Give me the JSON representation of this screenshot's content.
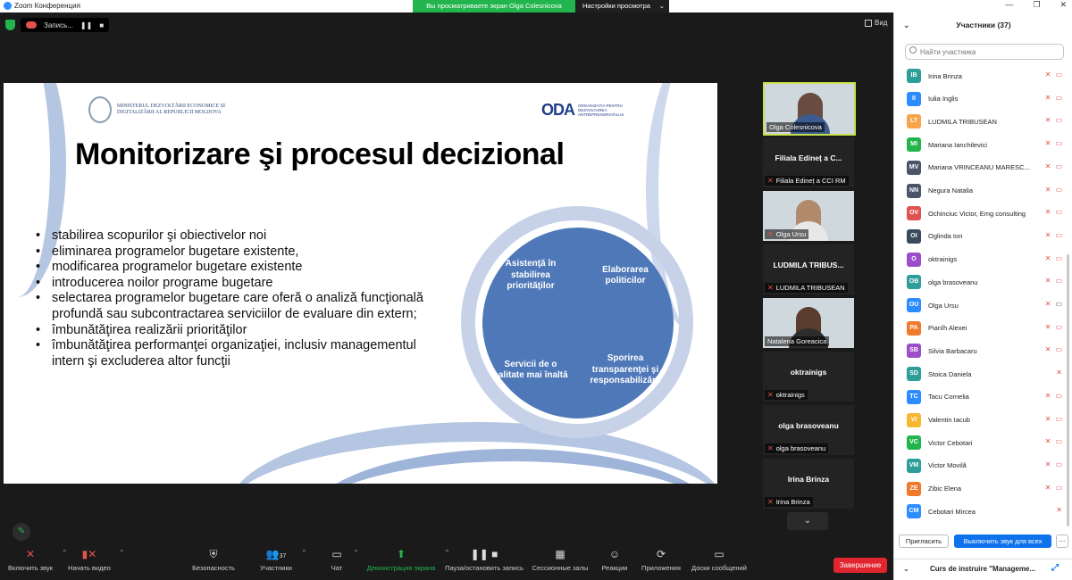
{
  "window": {
    "app_title": "Zoom Конференция",
    "controls": [
      "—",
      "❐",
      "✕"
    ]
  },
  "share_banner": {
    "text": "Вы просматриваете экран Olga Colesnicova",
    "settings_label": "Настройки просмотра",
    "settings_caret": "⌄"
  },
  "meeting_top": {
    "recording_label": "Запись...",
    "pause_glyph": "❚❚",
    "stop_glyph": "■",
    "view_label": "Вид"
  },
  "slide": {
    "ministry_text": "MINISTERUL DEZVOLTĂRII ECONOMICE ȘI DIGITALIZĂRII AL REPUBLICII MOLDOVA",
    "oda_logo": "ODA",
    "oda_sub": "ORGANIZAȚIA PENTRU DEZVOLTAREA ANTREPRENORIATULUI",
    "title": "Monitorizare şi procesul decizional",
    "bullets": [
      "stabilirea scopurilor şi obiectivelor noi",
      "eliminarea programelor bugetare existente,",
      "modificarea programelor bugetare existente",
      "introducerea noilor programe bugetare",
      "selectarea programelor bugetare care oferă o analiză funcţională profundă sau subcontractarea serviciilor de evaluare din extern;",
      "îmbunătăţirea realizării priorităţilor",
      "îmbunătăţirea performanţei organizaţiei, inclusiv managementul intern şi excluderea altor funcţii"
    ],
    "cycle": [
      "Asistenţă în stabilirea priorităţilor",
      "Elaborarea politicilor",
      "Servicii de o calitate mai înaltă",
      "Sporirea transparenţei şi responsabilizării"
    ]
  },
  "video_tiles": [
    {
      "label": "Olga Colesnicova",
      "big_name": "",
      "muted": false,
      "video": true
    },
    {
      "label": "Filiala Edineț a CCI RM",
      "big_name": "Filiala Edineț a C...",
      "muted": true,
      "video": false
    },
    {
      "label": "Olga Ursu",
      "big_name": "",
      "muted": true,
      "video": true
    },
    {
      "label": "LUDMILA TRIBUSEAN",
      "big_name": "LUDMILA TRIBUS...",
      "muted": true,
      "video": false
    },
    {
      "label": "Natalena Goreacica",
      "big_name": "",
      "muted": false,
      "video": true
    },
    {
      "label": "oktrainigs",
      "big_name": "oktrainigs",
      "muted": true,
      "video": false
    },
    {
      "label": "olga brasoveanu",
      "big_name": "olga brasoveanu",
      "muted": true,
      "video": false
    },
    {
      "label": "Irina Brinza",
      "big_name": "Irina Brinza",
      "muted": true,
      "video": false
    }
  ],
  "video_scroll_glyph": "⌄",
  "toolbar": {
    "mute": "Включить звук",
    "video": "Начать видео",
    "security": "Безопасность",
    "participants": "Участники",
    "participants_count": "37",
    "chat": "Чат",
    "share": "Демонстрация экрана",
    "pause_record": "Пауза/остановить запись",
    "breakout": "Сессионные залы",
    "reactions": "Реакции",
    "apps": "Приложения",
    "whiteboard": "Доски сообщений",
    "end": "Завершение",
    "caret": "^"
  },
  "panel": {
    "title": "Участники (37)",
    "search_placeholder": "Найти участника",
    "participants": [
      {
        "initials": "IB",
        "name": "Irina Brinza",
        "color": "#2e9e9a",
        "video": false
      },
      {
        "initials": "II",
        "name": "Iulia Inglis",
        "color": "#2d8cff",
        "video": false
      },
      {
        "initials": "LT",
        "name": "LUDMILA TRIBUSEAN",
        "color": "#f7a44a",
        "video": false
      },
      {
        "initials": "MI",
        "name": "Mariana Ianchilevici",
        "color": "#23b54d",
        "video": false
      },
      {
        "initials": "MV",
        "name": "Mariana VRINCEANU MARESC...",
        "color": "#4a5568",
        "video": false
      },
      {
        "initials": "NN",
        "name": "Negura Natalia",
        "color": "#4a5568",
        "video": false
      },
      {
        "initials": "OV",
        "name": "Ochinciuc Victor, Emg consulting",
        "color": "#e0524f",
        "video": false
      },
      {
        "initials": "OI",
        "name": "Oglinda Ion",
        "color": "#3a4a5c",
        "video": false
      },
      {
        "initials": "O",
        "name": "oktrainigs",
        "color": "#9b4dca",
        "video": false
      },
      {
        "initials": "OB",
        "name": "olga brasoveanu",
        "color": "#2e9e9a",
        "video": false
      },
      {
        "initials": "OU",
        "name": "Olga Ursu",
        "color": "#2d8cff",
        "video": true
      },
      {
        "initials": "PA",
        "name": "Pianîh Alexei",
        "color": "#f07a2b",
        "video": false
      },
      {
        "initials": "SB",
        "name": "Silvia Barbacaru",
        "color": "#9b4dca",
        "video": false
      },
      {
        "initials": "SD",
        "name": "Stoica Daniela",
        "color": "#2e9e9a",
        "video": null
      },
      {
        "initials": "TC",
        "name": "Tacu Cornelia",
        "color": "#2d8cff",
        "video": false
      },
      {
        "initials": "VI",
        "name": "Valentin Iacub",
        "color": "#f7b731",
        "video": false
      },
      {
        "initials": "VC",
        "name": "Victor Cebotari",
        "color": "#23b54d",
        "video": false
      },
      {
        "initials": "VM",
        "name": "Victor Movilă",
        "color": "#2e9e9a",
        "video": false
      },
      {
        "initials": "ZE",
        "name": "Zibic Elena",
        "color": "#f07a2b",
        "video": false
      },
      {
        "initials": "CM",
        "name": "Cebotari Mircea",
        "color": "#2d8cff",
        "video": null
      }
    ],
    "invite_label": "Пригласить",
    "mute_all_label": "Выключить звук для всех",
    "more_label": "...",
    "chat_title": "Curs de instruire \"Manageme...",
    "collapse_glyph": "⌄"
  },
  "colors": {
    "accent": "#0e72ed",
    "share_green": "#23b54d",
    "end_red": "#e0252e",
    "slide_blue": "#4e78b8"
  }
}
